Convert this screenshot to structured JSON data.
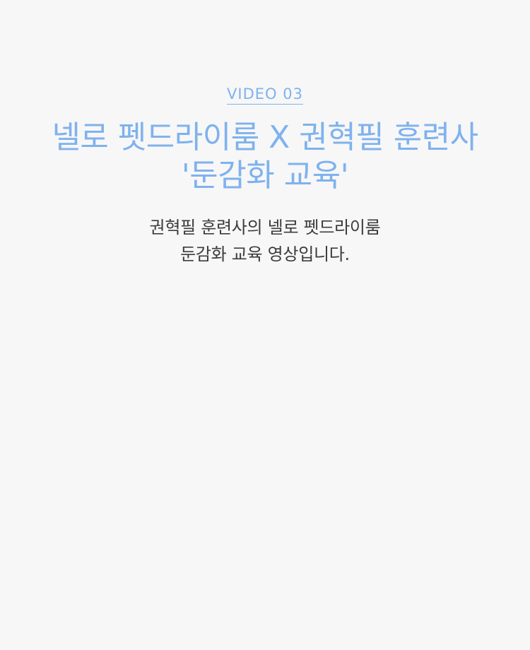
{
  "section": {
    "label": "VIDEO 03",
    "title_lines": [
      "넬로 펫드라이룸 X 권혁필 훈련사",
      "'둔감화 교육'"
    ],
    "description_lines": [
      "권혁필 훈련사의 넬로 펫드라이룸",
      "둔감화 교육 영상입니다."
    ]
  },
  "colors": {
    "background": "#f7f7f7",
    "accent": "#7fb2ee",
    "body_text": "#3c3c3c"
  }
}
